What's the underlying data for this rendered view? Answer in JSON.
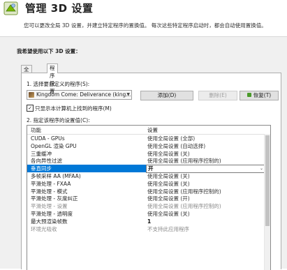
{
  "header": {
    "title": "管理 3D 设置",
    "description": "您可以更改全局 3D 设置，并建立特定程序的置换值。 每次这些特定程序启动时，都会自动使用置换值。"
  },
  "panel": {
    "section_title": "我希望使用以下 3D 设置：",
    "tabs": [
      {
        "label": "全局设置",
        "active": false
      },
      {
        "label": "程序设置",
        "active": true
      }
    ],
    "step1_label": "1. 选择要自定义的程序(S):",
    "program_select": {
      "value": "Kingdom Come: Deliverance (king...",
      "icon": "game-icon"
    },
    "buttons": {
      "add": "添加(D)",
      "remove": "删除(E)",
      "restore": "恢复(T)"
    },
    "checkbox": {
      "checked": true,
      "label": "只显示本计算机上找到的程序(M)"
    },
    "step2_label": "2. 指定该程序的设置值(C):",
    "table": {
      "headers": [
        "功能",
        "设置"
      ],
      "rows": [
        {
          "feature": "CUDA - GPUs",
          "setting": "使用全局设置 (全部)"
        },
        {
          "feature": "OpenGL 渲染 GPU",
          "setting": "使用全局设置 (自动选择)"
        },
        {
          "feature": "三重缓冲",
          "setting": "使用全局设置 (关)"
        },
        {
          "feature": "各向异性过滤",
          "setting": "使用全局设置 (应用程序控制的)"
        },
        {
          "feature": "垂直同步",
          "setting": "开",
          "selected": true
        },
        {
          "feature": "多帧采样 AA (MFAA)",
          "setting": "使用全局设置 (关)"
        },
        {
          "feature": "平滑处理 - FXAA",
          "setting": "使用全局设置 (关)"
        },
        {
          "feature": "平滑处理 - 模式",
          "setting": "使用全局设置 (应用程序控制的)"
        },
        {
          "feature": "平滑处理 - 灰度纠正",
          "setting": "使用全局设置 (开)"
        },
        {
          "feature": "平滑处理 - 设置",
          "setting": "使用全局设置 (应用程序控制的)",
          "dim": true
        },
        {
          "feature": "平滑处理 - 透明度",
          "setting": "使用全局设置 (关)"
        },
        {
          "feature": "最大预渲染帧数",
          "setting": "1",
          "bold": true
        },
        {
          "feature": "环境光吸收",
          "setting": "不支持此应用程序",
          "dim": true
        }
      ]
    }
  }
}
